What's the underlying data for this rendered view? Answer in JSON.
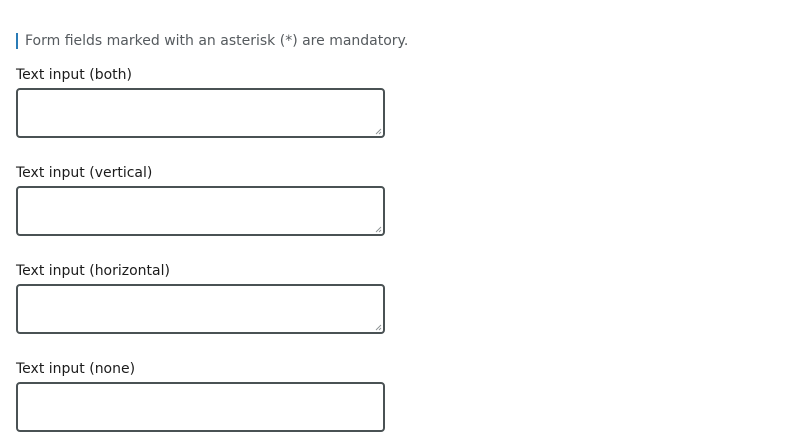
{
  "form": {
    "notice": "Form fields marked with an asterisk (*) are mandatory.",
    "fields": [
      {
        "label": "Text input (both)",
        "value": "",
        "resize": "both"
      },
      {
        "label": "Text input (vertical)",
        "value": "",
        "resize": "vertical"
      },
      {
        "label": "Text input (horizontal)",
        "value": "",
        "resize": "horizontal"
      },
      {
        "label": "Text input (none)",
        "value": "",
        "resize": "none"
      }
    ]
  },
  "colors": {
    "accent_bar": "#2a7bb6",
    "border": "#4a5254",
    "notice_text": "#555a5e",
    "label_text": "#1b1b1b"
  },
  "icons": {
    "resize_handle": "resize-grip-icon"
  }
}
